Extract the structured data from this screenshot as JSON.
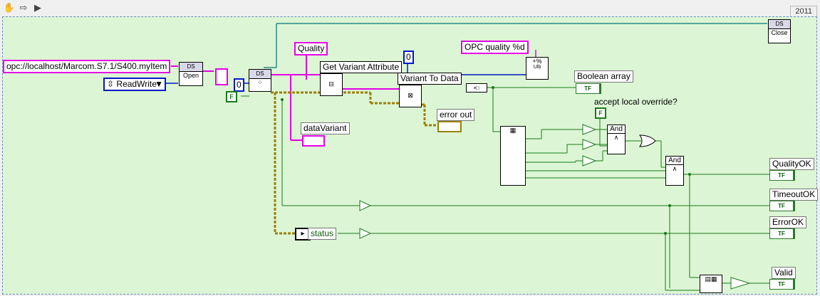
{
  "year": "2011",
  "constants": {
    "opc_url": "opc://localhost/Marcom.S7.1/S400.myItem",
    "access_mode": "ReadWrite",
    "quality_attr": "Quality",
    "format_string": "OPC quality %d",
    "zero_a": "0",
    "zero_b": "0",
    "false_a": "F",
    "false_b": "F"
  },
  "nodes": {
    "open": "Open",
    "close": "Close",
    "get_variant": "Get Variant Attribute",
    "variant_to_data": "Variant To Data",
    "and_a": "And",
    "and_b": "And",
    "format_suffix": "Ulb"
  },
  "labels": {
    "boolean_array": "Boolean array",
    "accept_override": "accept local override?",
    "error_out": "error out",
    "data_variant": "dataVariant",
    "status": "status",
    "quality_ok": "QualityOK",
    "timeout_ok": "TimeoutOK",
    "error_ok": "ErrorOK",
    "valid": "Valid"
  },
  "terminals": {
    "tf": "TF",
    "ds": "DS"
  },
  "colors": {
    "pink_wire": "#e600e6",
    "blue_wire": "#0018c8",
    "green_wire": "#1a7a1a",
    "error_wire": "#c8a800",
    "panel_bg": "#dcf5d4"
  }
}
